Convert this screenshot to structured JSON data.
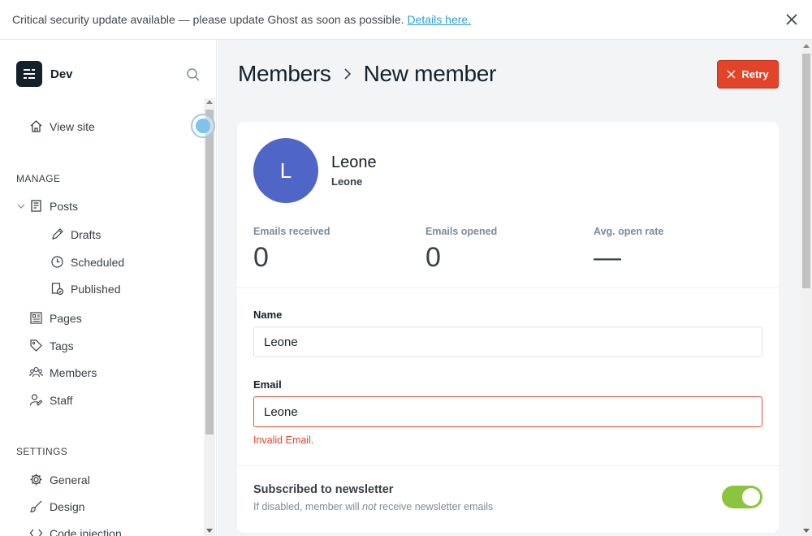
{
  "alert": {
    "message": "Critical security update available — please update Ghost as soon as possible.",
    "link": "Details here.",
    "close_icon": "close-icon"
  },
  "sidebar": {
    "site_name": "Dev",
    "search_icon": "search-icon",
    "view_site": "View site",
    "manage_title": "MANAGE",
    "posts": "Posts",
    "drafts": "Drafts",
    "scheduled": "Scheduled",
    "published": "Published",
    "pages": "Pages",
    "tags": "Tags",
    "members": "Members",
    "staff": "Staff",
    "settings_title": "SETTINGS",
    "general": "General",
    "design": "Design",
    "code_injection": "Code injection"
  },
  "header": {
    "crumb_parent": "Members",
    "crumb_current": "New member",
    "retry_label": "Retry"
  },
  "member": {
    "initial": "L",
    "name": "Leone",
    "subtitle": "Leone",
    "avatar_color": "#4f66c7"
  },
  "stats": [
    {
      "label": "Emails received",
      "value": "0"
    },
    {
      "label": "Emails opened",
      "value": "0"
    },
    {
      "label": "Avg. open rate",
      "value": "—"
    }
  ],
  "form": {
    "name_label": "Name",
    "name_value": "Leone",
    "email_label": "Email",
    "email_value": "Leone",
    "email_error": "Invalid Email.",
    "newsletter_title": "Subscribed to newsletter",
    "newsletter_desc_prefix": "If disabled, member will",
    "newsletter_desc_em": "not",
    "newsletter_desc_suffix": "receive newsletter emails",
    "newsletter_enabled": true
  },
  "colors": {
    "accent_red": "#e2442a",
    "toggle_green": "#8cc43f",
    "link_blue": "#2f9ed8"
  }
}
